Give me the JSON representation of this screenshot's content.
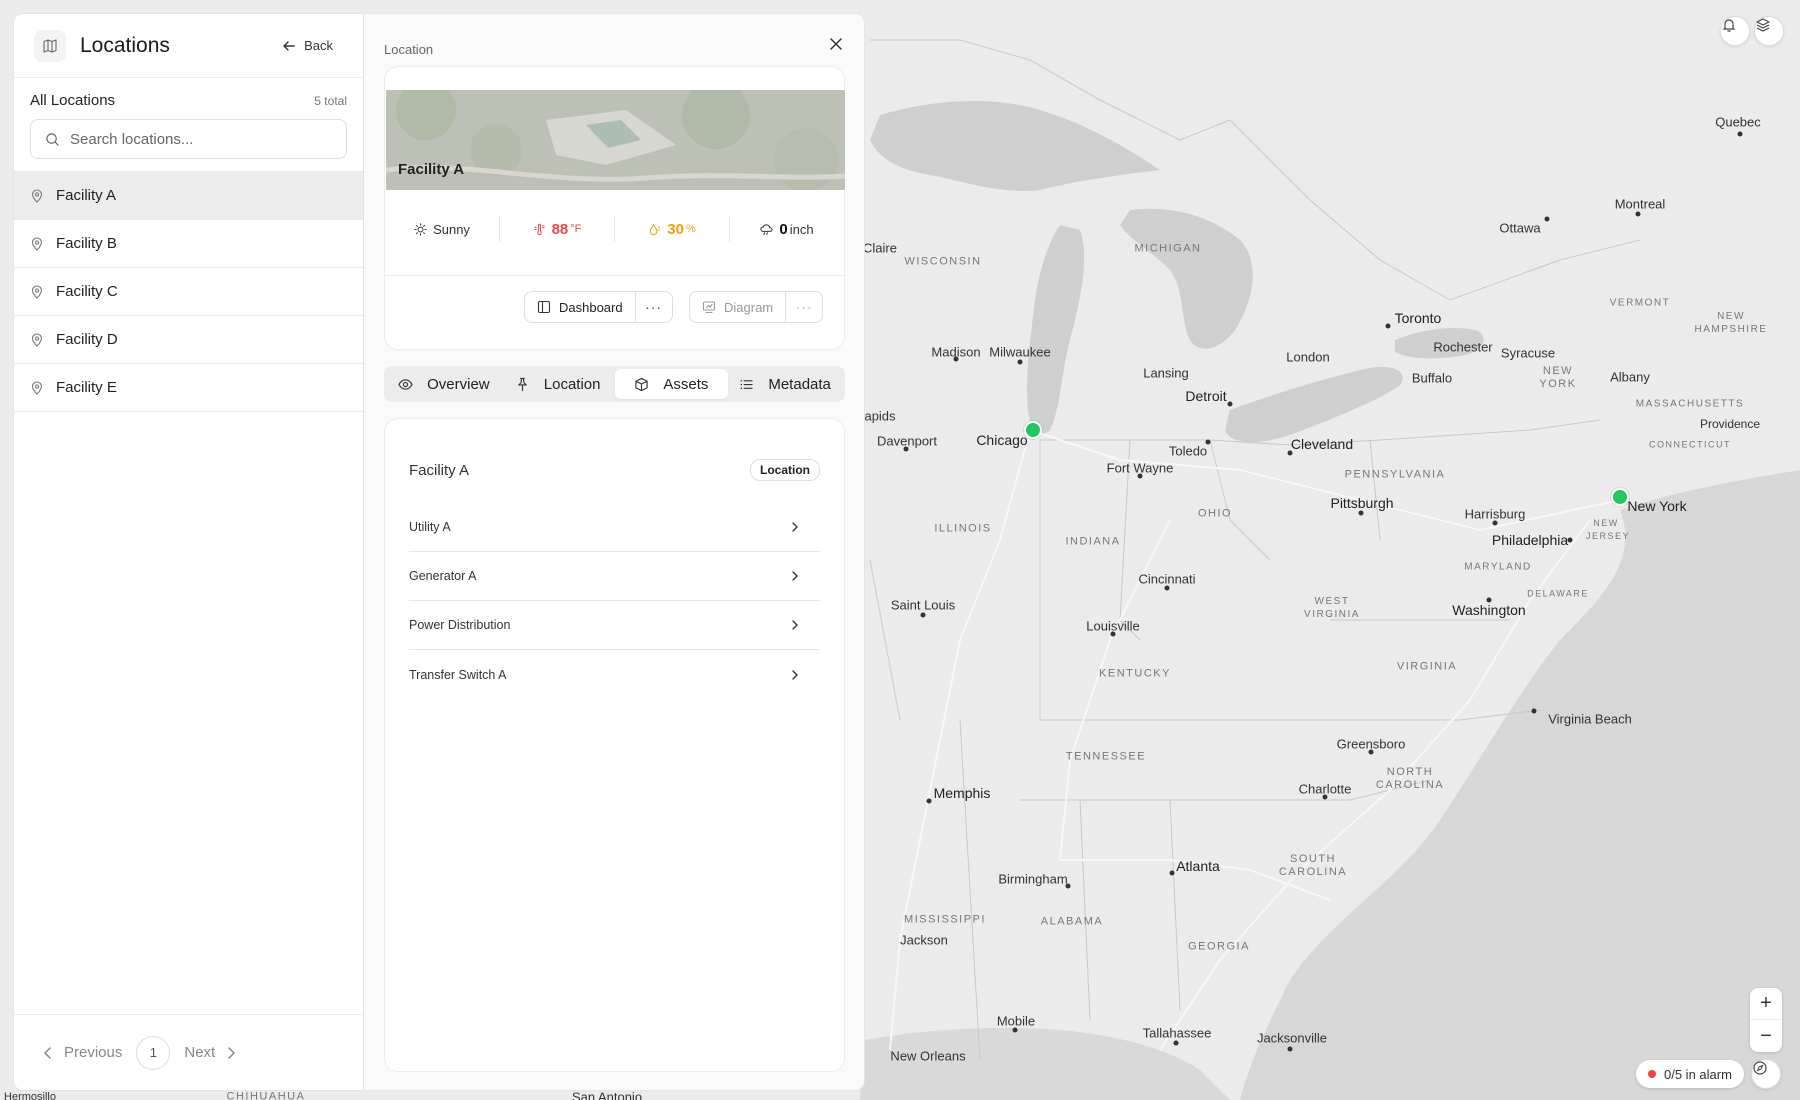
{
  "left_panel": {
    "title": "Locations",
    "back_label": "Back",
    "section_title": "All Locations",
    "count_text": "5 total",
    "search_placeholder": "Search locations...",
    "items": [
      {
        "label": "Facility A"
      },
      {
        "label": "Facility B"
      },
      {
        "label": "Facility C"
      },
      {
        "label": "Facility D"
      },
      {
        "label": "Facility E"
      }
    ],
    "pagination": {
      "previous": "Previous",
      "page": "1",
      "next": "Next"
    }
  },
  "detail": {
    "caption": "Location",
    "photo_title": "Facility A",
    "weather": {
      "condition": "Sunny",
      "temp_value": "88",
      "temp_unit": "°F",
      "humidity_value": "30",
      "humidity_unit": "%",
      "rain_value": "0",
      "rain_unit": "inch"
    },
    "buttons": {
      "dashboard": "Dashboard",
      "diagram": "Diagram",
      "more": "···"
    },
    "tabs": [
      {
        "label": "Overview"
      },
      {
        "label": "Location"
      },
      {
        "label": "Assets"
      },
      {
        "label": "Metadata"
      }
    ],
    "assets_title": "Facility A",
    "assets_badge": "Location",
    "assets": [
      {
        "label": "Utility A"
      },
      {
        "label": "Generator A"
      },
      {
        "label": "Power Distribution"
      },
      {
        "label": "Transfer Switch A"
      }
    ]
  },
  "map": {
    "alarm_text": "0/5 in alarm",
    "marker_color": "#22c55e",
    "alarm_color": "#ef4444",
    "cities": [
      "Quebec",
      "Montreal",
      "Ottawa",
      "Toronto",
      "Rochester",
      "Syracuse",
      "Albany",
      "London",
      "Buffalo",
      "Lansing",
      "Detroit",
      "Milwaukee",
      "Madison",
      "Chicago",
      "Davenport",
      "Toledo",
      "Cleveland",
      "Fort Wayne",
      "Pittsburgh",
      "Harrisburg",
      "Philadelphia",
      "New York",
      "Washington",
      "Cincinnati",
      "Louisville",
      "Saint Louis",
      "Virginia Beach",
      "Greensboro",
      "Charlotte",
      "Memphis",
      "Atlanta",
      "Birmingham",
      "Jackson",
      "Mobile",
      "Tallahassee",
      "Jacksonville",
      "New Orleans",
      "Claire",
      "apids",
      "Hermosillo",
      "San Antonio",
      "CHIHUAHUA"
    ],
    "regions": [
      "MICHIGAN",
      "WISCONSIN",
      "ILLINOIS",
      "INDIANA",
      "OHIO",
      "PENNSYLVANIA",
      "NEW YORK",
      "VERMONT",
      "NEW HAMPSHIRE",
      "MASSACHUSETTS",
      "CONNECTICUT",
      "NEW JERSEY",
      "MARYLAND",
      "DELAWARE",
      "WEST VIRGINIA",
      "VIRGINIA",
      "KENTUCKY",
      "TENNESSEE",
      "NORTH CAROLINA",
      "SOUTH CAROLINA",
      "MISSISSIPPI",
      "ALABAMA",
      "GEORGIA",
      "Providence"
    ]
  }
}
